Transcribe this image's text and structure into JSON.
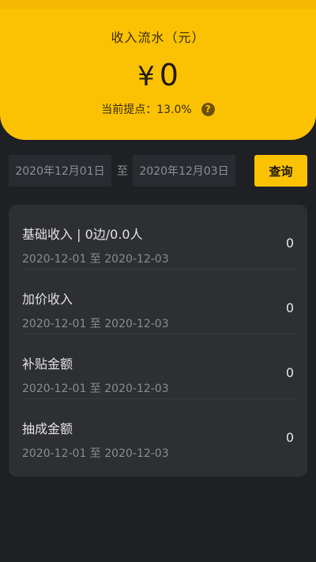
{
  "header": {
    "title": "收入流水（元）",
    "currency_symbol": "¥",
    "amount": "0",
    "rate_text": "当前提点：13.0%",
    "help_icon": "help-circle-icon",
    "help_glyph": "?"
  },
  "filter": {
    "start_date": "2020年12月01日",
    "separator": "至",
    "end_date": "2020年12月03日",
    "query_label": "查询"
  },
  "rows": [
    {
      "title": "基础收入 | 0边/0.0人",
      "date_range": "2020-12-01 至 2020-12-03",
      "value": "0"
    },
    {
      "title": "加价收入",
      "date_range": "2020-12-01 至 2020-12-03",
      "value": "0"
    },
    {
      "title": "补贴金额",
      "date_range": "2020-12-01 至 2020-12-03",
      "value": "0"
    },
    {
      "title": "抽成金额",
      "date_range": "2020-12-01 至 2020-12-03",
      "value": "0"
    }
  ],
  "colors": {
    "accent": "#fbc204",
    "background": "#1f2024",
    "card": "#2e2f33"
  }
}
